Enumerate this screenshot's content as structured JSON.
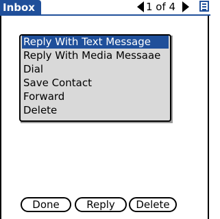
{
  "header": {
    "title": "Inbox",
    "pager": "1 of 4"
  },
  "menu": {
    "items": [
      {
        "label": "Reply With Text Message",
        "selected": true
      },
      {
        "label": "Reply With Media Messaae",
        "selected": false
      },
      {
        "label": "Dial",
        "selected": false
      },
      {
        "label": "Save Contact",
        "selected": false
      },
      {
        "label": "Forward",
        "selected": false
      },
      {
        "label": "Delete",
        "selected": false
      }
    ]
  },
  "buttons": {
    "done": "Done",
    "reply": "Reply",
    "delete": "Delete"
  },
  "colors": {
    "accent": "#1f4f9a",
    "popup_bg": "#d9d9d9"
  },
  "icons": {
    "prev": "triangle-left-icon",
    "next": "triangle-right-icon",
    "menu": "menu-list-icon"
  }
}
